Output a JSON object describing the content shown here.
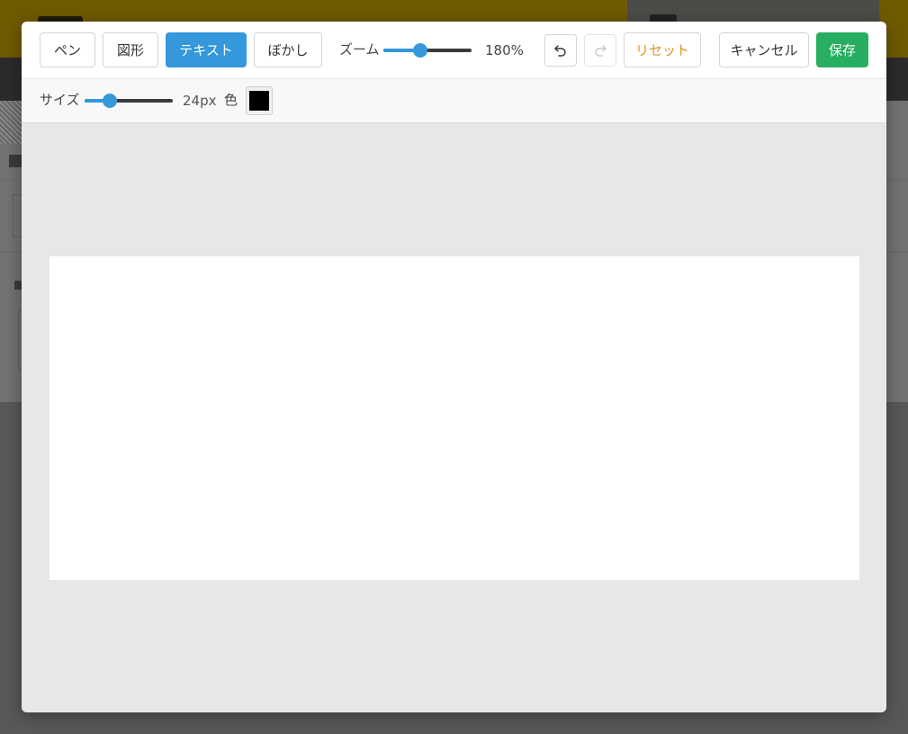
{
  "toolbar": {
    "tools": [
      {
        "label": "ペン",
        "active": false
      },
      {
        "label": "図形",
        "active": false
      },
      {
        "label": "テキスト",
        "active": true
      },
      {
        "label": "ぼかし",
        "active": false
      }
    ],
    "zoom_label": "ズーム",
    "zoom_value": "180%",
    "zoom_level_fraction": 0.42,
    "undo_icon": "undo-icon",
    "redo_icon": "redo-icon",
    "reset_label": "リセット",
    "cancel_label": "キャンセル",
    "save_label": "保存"
  },
  "subbar": {
    "size_label": "サイズ",
    "size_value": "24px",
    "size_level_fraction": 0.29,
    "color_label": "色",
    "color_value": "#000000"
  },
  "colors": {
    "accent": "#3498db",
    "save": "#27ae60",
    "reset": "#e09420",
    "stage_bg": "#e7e7e7",
    "canvas_bg": "#ffffff"
  }
}
